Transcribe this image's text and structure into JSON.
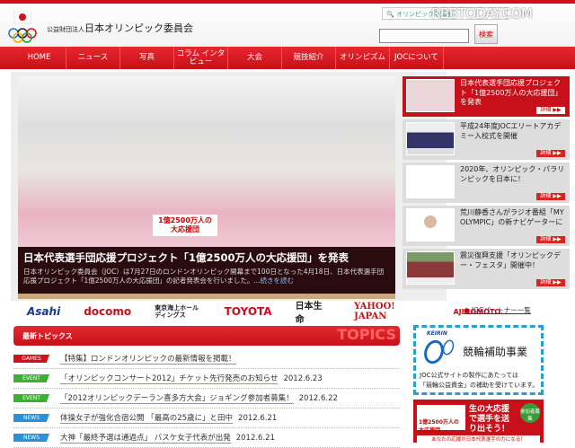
{
  "header": {
    "org_prefix": "公益財団法人",
    "org_name": "日本オリンピック委員会",
    "site_search_link": "オリンピックを知る",
    "watermark": "RBBTODAY.COM",
    "search_placeholder": "",
    "search_button": "検索"
  },
  "nav": [
    "HOME",
    "ニュース",
    "写真",
    "コラム インタビュー",
    "大会",
    "競技紹介",
    "オリンピズム",
    "JOCについて"
  ],
  "hero": {
    "title": "日本代表選手団応援プロジェクト「1億2500万人の大応援団」を発表",
    "body": "日本オリンピック委員会（JOC）は7月27日のロンドンオリンピック開幕まで100日となった4月18日、日本代表選手団応援プロジェクト「1億2500万人の大応援団」の記者発表会を行いました。...",
    "read_more": "続きを読む",
    "banner": "1億2500万人の大応援団"
  },
  "side_items": [
    {
      "text": "日本代表選手団応援プロジェクト「1億2500万人の大応援団」を発表",
      "more": "詳細 ▶▶"
    },
    {
      "text": "平成24年度JOCエリートアカデミー入校式を開催",
      "more": "詳細 ▶▶"
    },
    {
      "text": "2020年、オリンピック・パラリンピックを日本に！",
      "more": "詳細 ▶▶"
    },
    {
      "text": "荒川静香さんがラジオ番組「MY OLYMPIC」の新ナビゲーターに",
      "more": "詳細 ▶▶"
    },
    {
      "text": "震災復興支援「オリンピックデー・フェスタ」開催中！",
      "more": "詳細 ▶▶"
    }
  ],
  "partners": {
    "logos": [
      "Asahi",
      "docomo",
      "東京海上ホールディングス",
      "TOYOTA",
      "日本生命",
      "YAHOO! JAPAN",
      "AJINOMOTO."
    ],
    "link": "JOCパートナー一覧"
  },
  "topics": {
    "title": "最新トピックス",
    "watermark": "TOPICS",
    "colors": {
      "GAMES": "#d0101a",
      "EVENT": "#3cb030",
      "NEWS": "#2a90d8"
    },
    "rows": [
      {
        "tag": "GAMES",
        "text": "【特集】ロンドンオリンピックの最新情報を掲載！",
        "date": ""
      },
      {
        "tag": "EVENT",
        "text": "「オリンピックコンサート2012」チケット先行発売のお知らせ",
        "date": "2012.6.23"
      },
      {
        "tag": "EVENT",
        "text": "「2012オリンピックデーラン喜多方大会」ジョギング参加者募集！",
        "date": "2012.6.22"
      },
      {
        "tag": "NEWS",
        "text": "体操女子が強化合宿公開 「最高の25歳に」と田中",
        "date": "2012.6.21"
      },
      {
        "tag": "NEWS",
        "text": "大神「最終予選は通過点」 バスケ女子代表が出発",
        "date": "2012.6.21"
      }
    ]
  },
  "keirin": {
    "brand": "KEIRIN",
    "title": "競輪補助事業",
    "line1": "JOC公式サイトの製作にあたっては",
    "line2": "「競輪公益資金」の補助を受けています。"
  },
  "support_banner": {
    "logo_text": "1億2500万人の大応援団",
    "main": "生の大応援で選手を送り出そう！",
    "badge": "参加者募集",
    "footer": "あなたの応援が日本代表選手の力になる！"
  }
}
